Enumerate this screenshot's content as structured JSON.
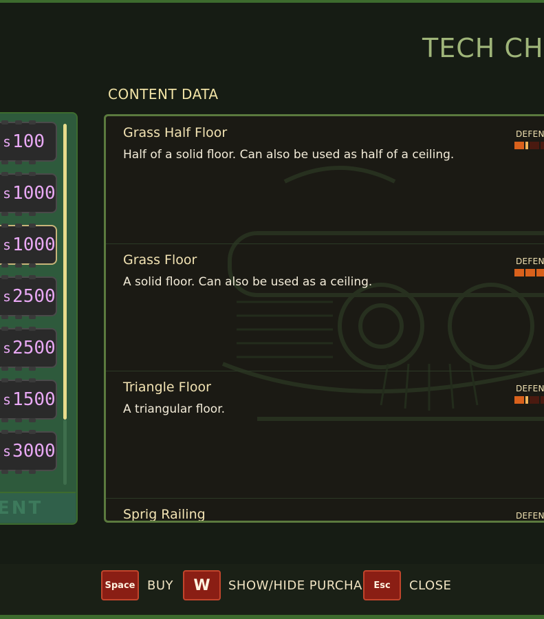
{
  "title": "TECH CH",
  "section_title": "CONTENT DATA",
  "currency_symbol": "s",
  "prices": [
    {
      "value": "100"
    },
    {
      "value": "1000"
    },
    {
      "value": "1000",
      "selected": true
    },
    {
      "value": "2500"
    },
    {
      "value": "2500"
    },
    {
      "value": "1500"
    },
    {
      "value": "3000"
    }
  ],
  "panel_footer": "ENT",
  "entries": [
    {
      "name": "Grass Half Floor",
      "desc": "Half of a solid floor. Can also be used as half of a ceiling.",
      "defense_label": "DEFENS",
      "defense_level": 1
    },
    {
      "name": "Grass Floor",
      "desc": "A solid floor. Can also be used as a ceiling.",
      "defense_label": "DEFENS",
      "defense_level": 3
    },
    {
      "name": "Triangle Floor",
      "desc": "A triangular floor.",
      "defense_label": "DEFENS",
      "defense_level": 1
    },
    {
      "name": "Sprig Railing",
      "desc": "",
      "defense_label": "DEFENS",
      "defense_level": 0
    }
  ],
  "controls": [
    {
      "key": "Space",
      "label": "BUY"
    },
    {
      "key": "W",
      "label": "SHOW/HIDE PURCHASED"
    },
    {
      "key": "Esc",
      "label": "CLOSE"
    }
  ],
  "colors": {
    "accent": "#9fb579",
    "price": "#e9a9f5",
    "defense": "#d9611c",
    "key": "#8a1e14"
  }
}
